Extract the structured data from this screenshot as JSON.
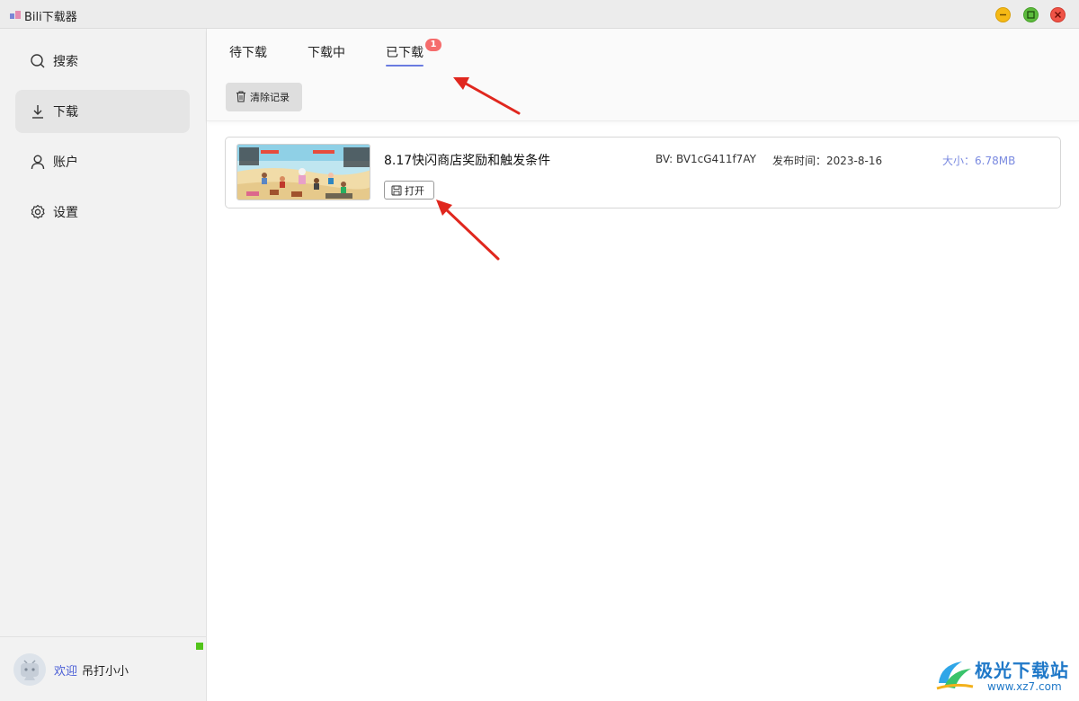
{
  "window": {
    "title": "Bili下载器",
    "controls": [
      "minimize-icon",
      "maximize-icon",
      "close-icon"
    ],
    "colors": {
      "minimize": "#f5b915",
      "maximize": "#5dbb3d",
      "close": "#ef5346"
    }
  },
  "sidebar": {
    "items": [
      {
        "label": "搜索",
        "icon": "search-icon",
        "active": false
      },
      {
        "label": "下载",
        "icon": "download-icon",
        "active": true
      },
      {
        "label": "账户",
        "icon": "user-icon",
        "active": false
      },
      {
        "label": "设置",
        "icon": "gear-icon",
        "active": false
      }
    ],
    "footer": {
      "welcome": "欢迎",
      "username": "吊打小小",
      "status_color": "#52c41a"
    }
  },
  "main": {
    "tabs": [
      {
        "label": "待下载",
        "active": false
      },
      {
        "label": "下载中",
        "active": false
      },
      {
        "label": "已下载",
        "active": true,
        "badge": "1"
      }
    ],
    "clear_button": {
      "label": "清除记录",
      "icon": "trash-icon"
    },
    "downloads": [
      {
        "title": "8.17快闪商店奖励和触发条件",
        "open_label": "打开",
        "open_icon": "save-icon",
        "bv": "BV: BV1cG411f7AY",
        "publish_time": "发布时间：2023-8-16",
        "size": "大小：6.78MB"
      }
    ],
    "accent_color": "#6a7be0"
  },
  "watermark": {
    "text": "极光下载站",
    "url": "www.xz7.com"
  }
}
